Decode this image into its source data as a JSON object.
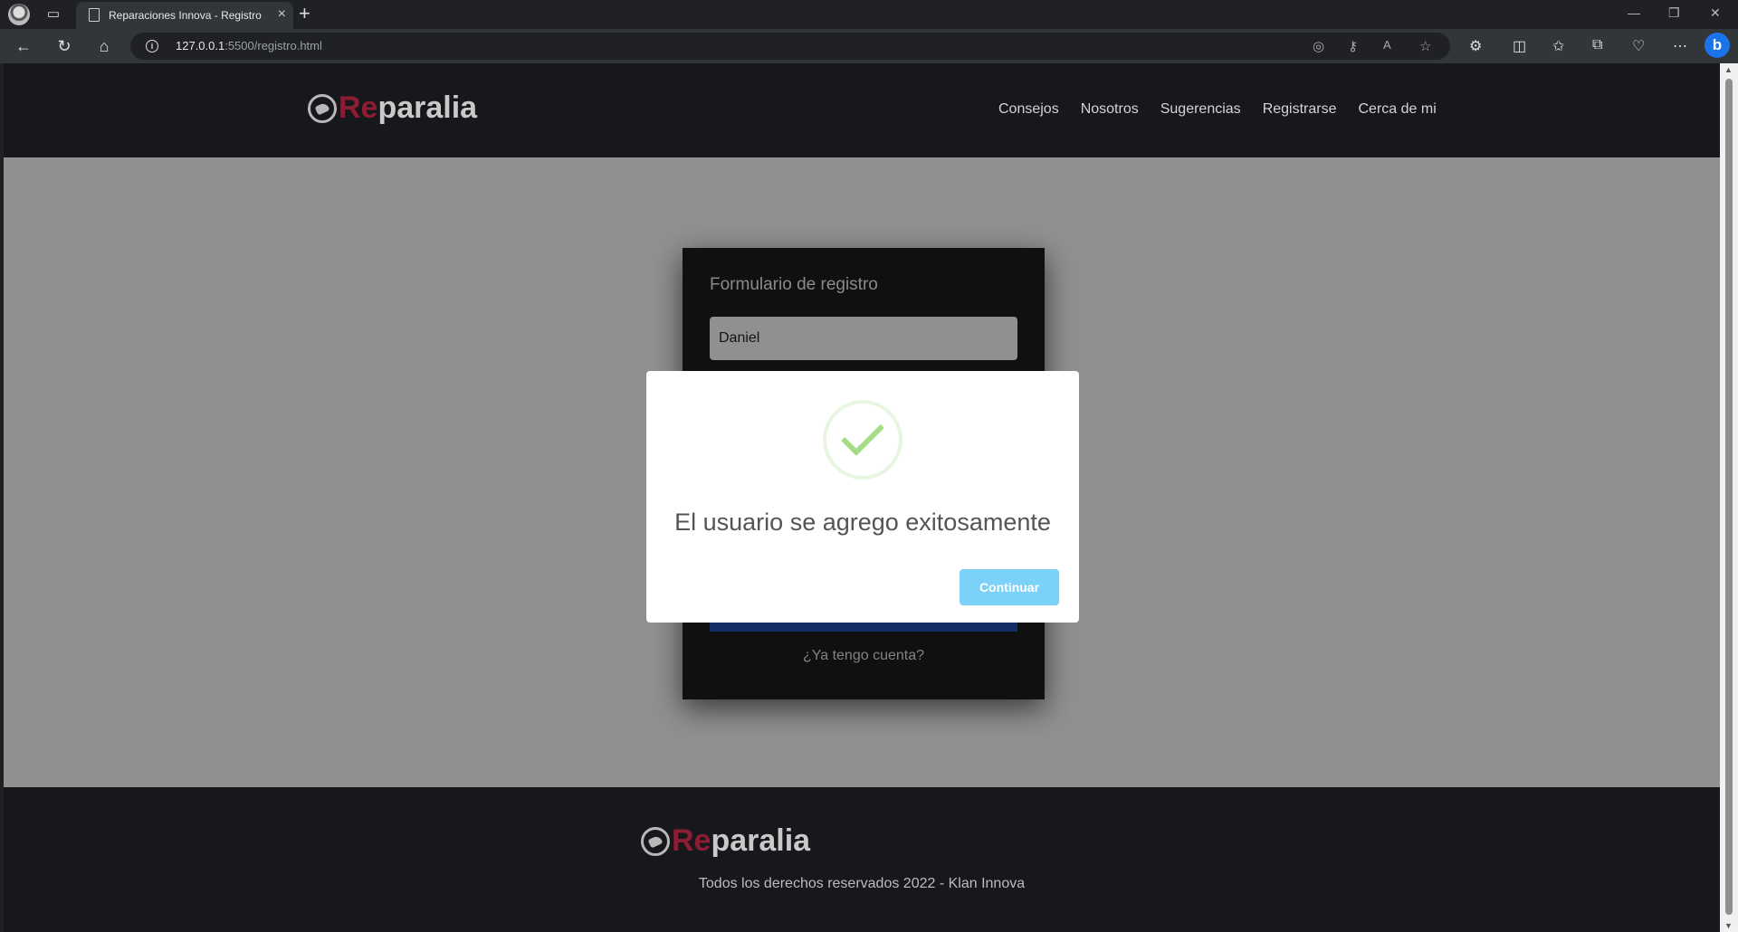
{
  "browser": {
    "tab_title": "Reparaciones Innova - Registro",
    "url_host": "127.0.0.1",
    "url_path": ":5500/registro.html"
  },
  "site": {
    "logo": {
      "prefix": "Re",
      "suffix": "paralia"
    },
    "nav": [
      "Consejos",
      "Nosotros",
      "Sugerencias",
      "Registrarse",
      "Cerca de mi"
    ],
    "footer_text": "Todos los derechos reservados 2022 - Klan Innova"
  },
  "form": {
    "title": "Formulario de registro",
    "name_value": "Daniel",
    "login_link": "¿Ya tengo cuenta?"
  },
  "modal": {
    "title": "El usuario se agrego exitosamente",
    "confirm_label": "Continuar"
  },
  "colors": {
    "brand_red": "#8c1d35",
    "success_green": "#a5dc86",
    "confirm_blue": "#7cd1f9"
  }
}
